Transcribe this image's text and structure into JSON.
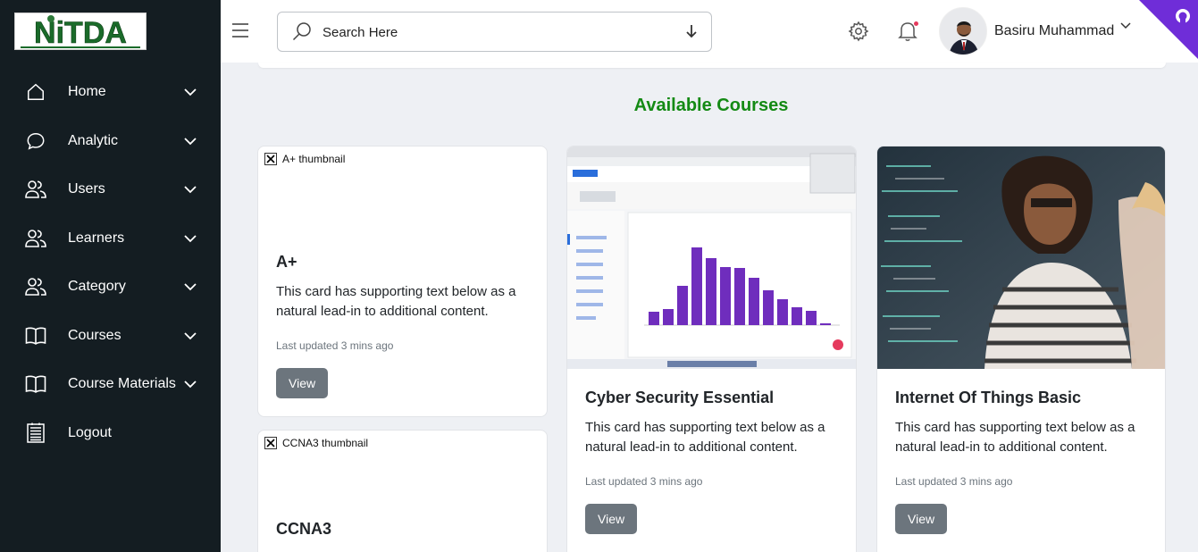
{
  "brand": {
    "logo_text": "NiTDA"
  },
  "sidebar": {
    "items": [
      {
        "label": "Home",
        "icon": "home-icon"
      },
      {
        "label": "Analytic",
        "icon": "chat-bubble-icon"
      },
      {
        "label": "Users",
        "icon": "users-icon"
      },
      {
        "label": "Learners",
        "icon": "users-icon"
      },
      {
        "label": "Category",
        "icon": "users-icon"
      },
      {
        "label": "Courses",
        "icon": "book-icon"
      },
      {
        "label": "Course Materials",
        "icon": "book-icon"
      },
      {
        "label": "Logout",
        "icon": "document-list-icon"
      }
    ]
  },
  "header": {
    "search_placeholder": "Search Here",
    "user_name": "Basiru Muhammad"
  },
  "main": {
    "section_title": "Available Courses",
    "courses": [
      {
        "thumbnail_alt": "A+ thumbnail",
        "title": "A+",
        "text": "This card has supporting text below as a natural lead-in to additional content.",
        "updated": "Last updated 3 mins ago",
        "button": "View"
      },
      {
        "thumbnail_alt": "",
        "title": "Cyber Security Essential",
        "text": "This card has supporting text below as a natural lead-in to additional content.",
        "updated": "Last updated 3 mins ago",
        "button": "View"
      },
      {
        "thumbnail_alt": "",
        "title": "Internet Of Things Basic",
        "text": "This card has supporting text below as a natural lead-in to additional content.",
        "updated": "Last updated 3 mins ago",
        "button": "View"
      },
      {
        "thumbnail_alt": "CCNA3 thumbnail",
        "title": "CCNA3"
      }
    ]
  },
  "colors": {
    "sidebar_bg": "#141d22",
    "title_green": "#148a14",
    "button_gray": "#6c757d",
    "corner_purple": "#6f2dd8"
  }
}
